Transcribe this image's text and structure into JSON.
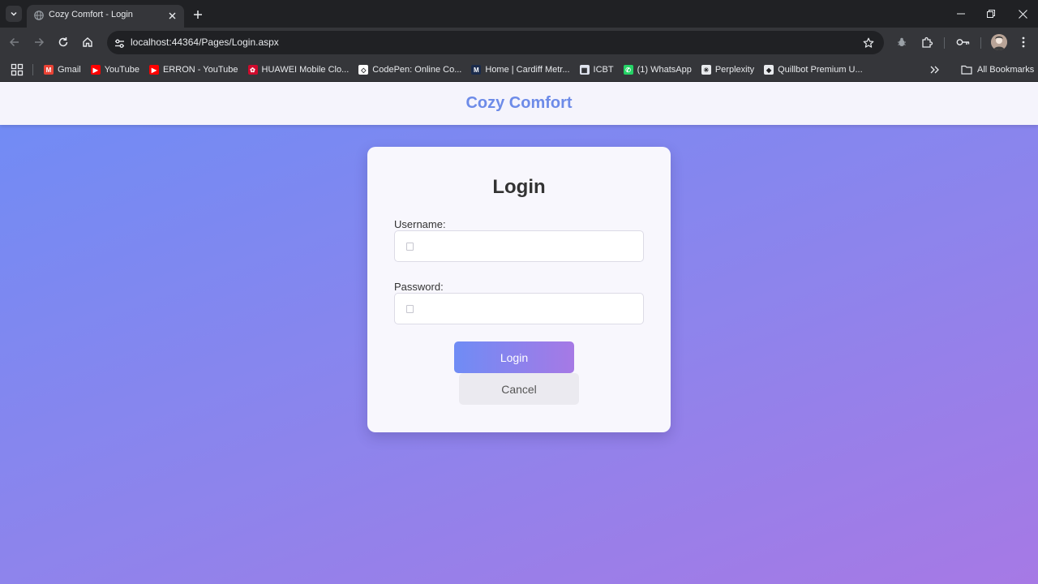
{
  "browser": {
    "tab": {
      "title": "Cozy Comfort - Login"
    },
    "address_bar": {
      "url": "localhost:44364/Pages/Login.aspx"
    },
    "bookmarks": [
      {
        "label": "Gmail",
        "icon": "gmail-icon",
        "color": "#ea4335"
      },
      {
        "label": "YouTube",
        "icon": "youtube-icon",
        "color": "#ff0000"
      },
      {
        "label": "ERRON - YouTube",
        "icon": "youtube-icon",
        "color": "#ff0000"
      },
      {
        "label": "HUAWEI Mobile Clo...",
        "icon": "huawei-icon",
        "color": "#cf0a2c"
      },
      {
        "label": "CodePen: Online Co...",
        "icon": "codepen-icon",
        "color": "#ffffff"
      },
      {
        "label": "Home | Cardiff Metr...",
        "icon": "cardiff-met-icon",
        "color": "#1a2b4c"
      },
      {
        "label": "ICBT",
        "icon": "icbt-icon",
        "color": "#dfe3ee"
      },
      {
        "label": "(1) WhatsApp",
        "icon": "whatsapp-icon",
        "color": "#25d366"
      },
      {
        "label": "Perplexity",
        "icon": "perplexity-icon",
        "color": "#e8eaed"
      },
      {
        "label": "Quillbot Premium U...",
        "icon": "quillbot-icon",
        "color": "#e8eaed"
      }
    ],
    "all_bookmarks_label": "All Bookmarks"
  },
  "page": {
    "site_title": "Cozy Comfort",
    "login_card": {
      "heading": "Login",
      "username_label": "Username:",
      "username_value": "",
      "password_label": "Password:",
      "password_value": "",
      "login_button": "Login",
      "cancel_button": "Cancel"
    }
  },
  "colors": {
    "accent": "#6d8be8",
    "gradient_start": "#6f8cf5",
    "gradient_end": "#a679e5"
  }
}
